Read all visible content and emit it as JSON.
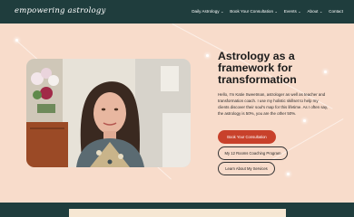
{
  "header": {
    "logo_text": "empowering astrology",
    "nav": [
      {
        "label": "Daily Astrology",
        "has_dropdown": true,
        "icon": "chevron-down-icon"
      },
      {
        "label": "Book Your Consultation",
        "has_dropdown": true,
        "icon": "chevron-down-icon"
      },
      {
        "label": "Events",
        "has_dropdown": true,
        "icon": "chevron-down-icon"
      },
      {
        "label": "About",
        "has_dropdown": true,
        "icon": "chevron-down-icon"
      },
      {
        "label": "Contact",
        "has_dropdown": false
      }
    ],
    "chevron": "⌄"
  },
  "hero": {
    "title": "Astrology as a framework for transformation",
    "bio": "Hello, I'm Katie Sweetman, astrologer as well as teacher and transformation coach. I use my holistic skillset to help my clients discover their soul's map for this lifetime. As I often say, the astrology is 50%, you are the other 50%.",
    "buttons": {
      "consultation": "Book Your Consultation",
      "coaching": "My 12 Rooms Coaching Program",
      "services": "Learn About My Services"
    }
  },
  "colors": {
    "header_bg": "#1f3d3d",
    "hero_bg": "#f8dccb",
    "accent": "#c8412b",
    "text": "#1b1b1b",
    "footer_card": "#f6e7d3"
  }
}
